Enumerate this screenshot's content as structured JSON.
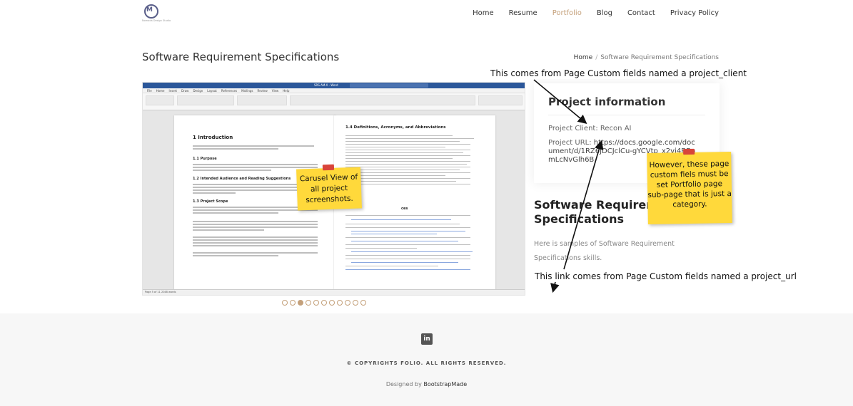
{
  "header": {
    "logo_icon": "m-circle-logo",
    "logo_tag": "Nomada Design Studio",
    "nav": [
      "Home",
      "Resume",
      "Portfolio",
      "Blog",
      "Contact",
      "Privacy Policy"
    ],
    "active_nav": "Portfolio"
  },
  "breadcrumb": {
    "title": "Software Requirement Specifications",
    "home": "Home",
    "separator": "/",
    "current": "Software Requirement Specifications"
  },
  "slider": {
    "doc_title": "SRS AM-X - Word",
    "menu": [
      "File",
      "Home",
      "Insert",
      "Draw",
      "Design",
      "Layout",
      "References",
      "Mailings",
      "Review",
      "View",
      "Help"
    ],
    "left_page": {
      "h1": "1  Introduction",
      "h2_purpose": "1.1  Purpose",
      "h2_audience": "1.2  Intended Audience and Reading Suggestions",
      "h2_scope": "1.3  Project Scope"
    },
    "right_page": {
      "h2": "1.4  Definitions, Acronyms, and Abbreviations",
      "h2_refs": "ces"
    },
    "status": "Page 5 of 11   2048 words",
    "dots_total": 11,
    "dots_active_index": 2
  },
  "project_info": {
    "title": "Project information",
    "client_label": "Project Client:",
    "client_value": "Recon AI",
    "url_label": "Project URL:",
    "url_value": "https://docs.google.com/document/d/1RZ6JDCJclCu-gYCVtp_x2vi4BBomLcNvGlh6B"
  },
  "description": {
    "title": "Software Requirement Specifications",
    "text": "Here is samples of Software Requirement Specifications skills."
  },
  "annotations": {
    "client_note": "This comes from Page Custom fields named a project_client",
    "url_note": "This link comes from Page Custom fields named a project_url",
    "sticky_carousel": "Carusel View of all project screenshots.",
    "sticky_subpage": "However, these page custom fiels must be set Portfolio page sub-page that is just a category."
  },
  "footer": {
    "social_icon": "linkedin-icon",
    "social_label": "in",
    "copyright": "© COPYRIGHTS FOLIO. ALL RIGHTS RESERVED.",
    "credits_prefix": "Designed by",
    "credits_link": "BootstrapMade"
  },
  "colors": {
    "accent": "#c4a07a",
    "sticky": "#ffd93b",
    "tape": "#d8443a",
    "word_blue": "#2b579a"
  }
}
